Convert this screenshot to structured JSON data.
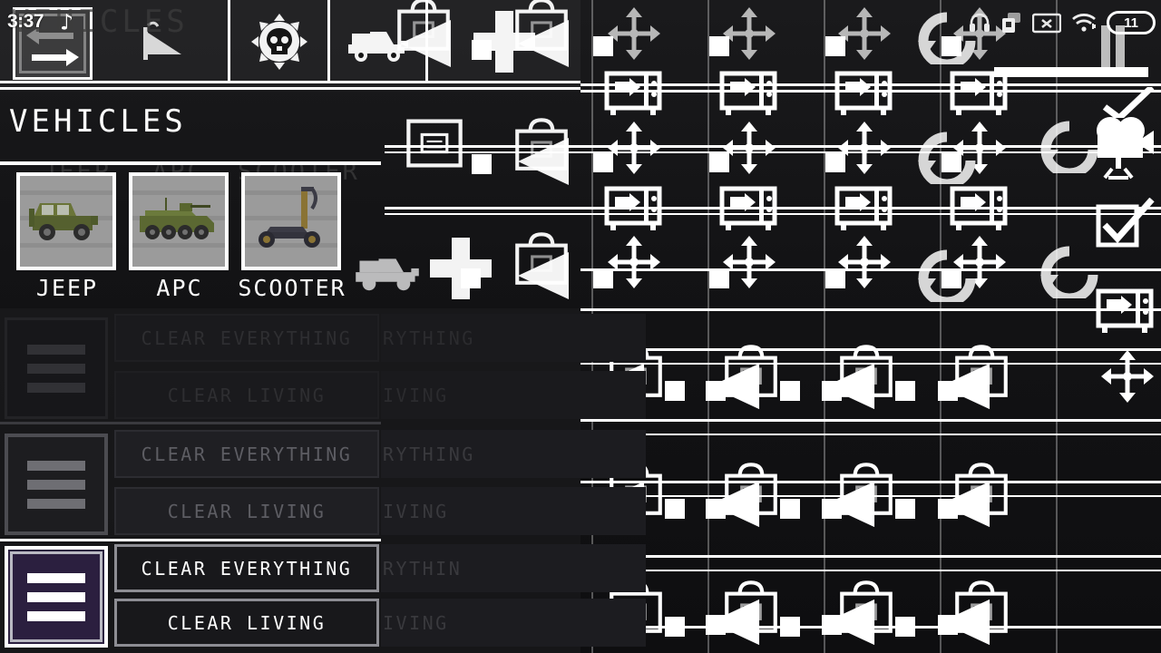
{
  "status_bar": {
    "clock": "3:37",
    "music_note": "♪",
    "battery_level": "11",
    "icons": [
      "headphones-icon",
      "rotation-lock-icon",
      "close-badge-icon",
      "wifi-icon",
      "battery-icon"
    ]
  },
  "toolbar": {
    "swap_button": "swap-arrows-icon",
    "items": [
      {
        "name": "ramp-flag-icon",
        "label": ""
      },
      {
        "name": "skull-gear-icon",
        "label": ""
      },
      {
        "name": "jeep-icon",
        "label": ""
      },
      {
        "name": "plus-icon",
        "label": ""
      }
    ]
  },
  "vehicles_panel": {
    "title": "VEHICLES",
    "cards": [
      {
        "label": "JEEP",
        "thumb": "jeep-thumbnail"
      },
      {
        "label": "APC",
        "thumb": "apc-thumbnail"
      },
      {
        "label": "SCOOTER",
        "thumb": "scooter-thumbnail"
      }
    ]
  },
  "clear_dialogs": [
    {
      "state": "ghost-faint",
      "menu_icon": "hamburger-menu-icon",
      "clear_everything": "CLEAR EVERYTHING",
      "clear_living": "CLEAR LIVING"
    },
    {
      "state": "ghost-mid",
      "menu_icon": "hamburger-menu-icon",
      "clear_everything": "CLEAR EVERYTHING",
      "clear_living": "CLEAR LIVING"
    },
    {
      "state": "active",
      "menu_icon": "hamburger-menu-icon",
      "clear_everything": "CLEAR EVERYTHING",
      "clear_living": "CLEAR LIVING"
    }
  ],
  "ghost_text": {
    "everything_tail": "RYTHING",
    "everything_tail_cut": "RYTHIN",
    "living_tail": "IVING",
    "living_tail_cut": "IVING",
    "vehicles": "VEHICLES",
    "jeep": "JEEP",
    "apc": "APC",
    "scooter": "SCOOTER"
  },
  "icon_field": {
    "row_icons": [
      "move-arrows-icon",
      "tv-monitor-icon",
      "bag-icon",
      "play-triangle-icon",
      "undo-arrow-icon"
    ],
    "columns": 4,
    "description": "repeating ghosted duplicate UI icon grid"
  },
  "right_column": {
    "items": [
      "film-camera-icon",
      "checkbox-checked-icon",
      "tv-monitor-icon",
      "move-arrows-icon",
      "pause-icon"
    ]
  },
  "colors": {
    "background": "#111112",
    "panel": "#1b1b1d",
    "accent_white": "#ffffff",
    "active_purple": "#2b1f3f",
    "card_bg": "#9a9a9a",
    "ghost_text": "#3a3a3a",
    "mid_text": "#6f6f6f"
  }
}
